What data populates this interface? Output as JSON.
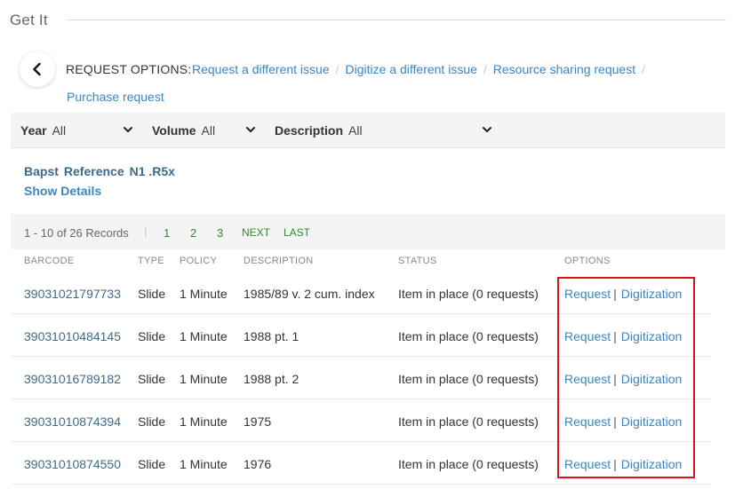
{
  "header": {
    "title": "Get It"
  },
  "request_options": {
    "label": "REQUEST OPTIONS:",
    "links": [
      "Request a different issue",
      "Digitize a different issue",
      "Resource sharing request"
    ],
    "link2": "Purchase request",
    "separator": "/"
  },
  "filters": {
    "year": {
      "label": "Year",
      "value": "All"
    },
    "volume": {
      "label": "Volume",
      "value": "All"
    },
    "description": {
      "label": "Description",
      "value": "All"
    }
  },
  "location": {
    "library": "Bapst",
    "collection": "Reference",
    "call_number": "N1 .R5x",
    "show_details": "Show Details"
  },
  "pagination": {
    "summary": "1 - 10 of 26 Records",
    "divider": "|",
    "pages": [
      "1",
      "2",
      "3"
    ],
    "next": "NEXT",
    "last": "LAST"
  },
  "table": {
    "headers": [
      "BARCODE",
      "TYPE",
      "POLICY",
      "DESCRIPTION",
      "STATUS",
      "OPTIONS"
    ],
    "rows": [
      {
        "barcode": "39031021797733",
        "type": "Slide",
        "policy": "1 Minute",
        "description": "1985/89 v. 2 cum. index",
        "status": "Item in place (0 requests)",
        "request": "Request",
        "sep": "|",
        "digitization": "Digitization"
      },
      {
        "barcode": "39031010484145",
        "type": "Slide",
        "policy": "1 Minute",
        "description": "1988 pt. 1",
        "status": "Item in place (0 requests)",
        "request": "Request",
        "sep": "|",
        "digitization": "Digitization"
      },
      {
        "barcode": "39031016789182",
        "type": "Slide",
        "policy": "1 Minute",
        "description": "1988 pt. 2",
        "status": "Item in place (0 requests)",
        "request": "Request",
        "sep": "|",
        "digitization": "Digitization"
      },
      {
        "barcode": "39031010874394",
        "type": "Slide",
        "policy": "1 Minute",
        "description": "1975",
        "status": "Item in place (0 requests)",
        "request": "Request",
        "sep": "|",
        "digitization": "Digitization"
      },
      {
        "barcode": "39031010874550",
        "type": "Slide",
        "policy": "1 Minute",
        "description": "1976",
        "status": "Item in place (0 requests)",
        "request": "Request",
        "sep": "|",
        "digitization": "Digitization"
      }
    ]
  },
  "colors": {
    "link": "#3a86c4",
    "barcode": "#3d6a8a",
    "page_link": "#2e8b2e",
    "highlight": "#e0111b"
  },
  "icons": {
    "back": "chevron-left-icon",
    "dropdown": "chevron-down-icon"
  }
}
